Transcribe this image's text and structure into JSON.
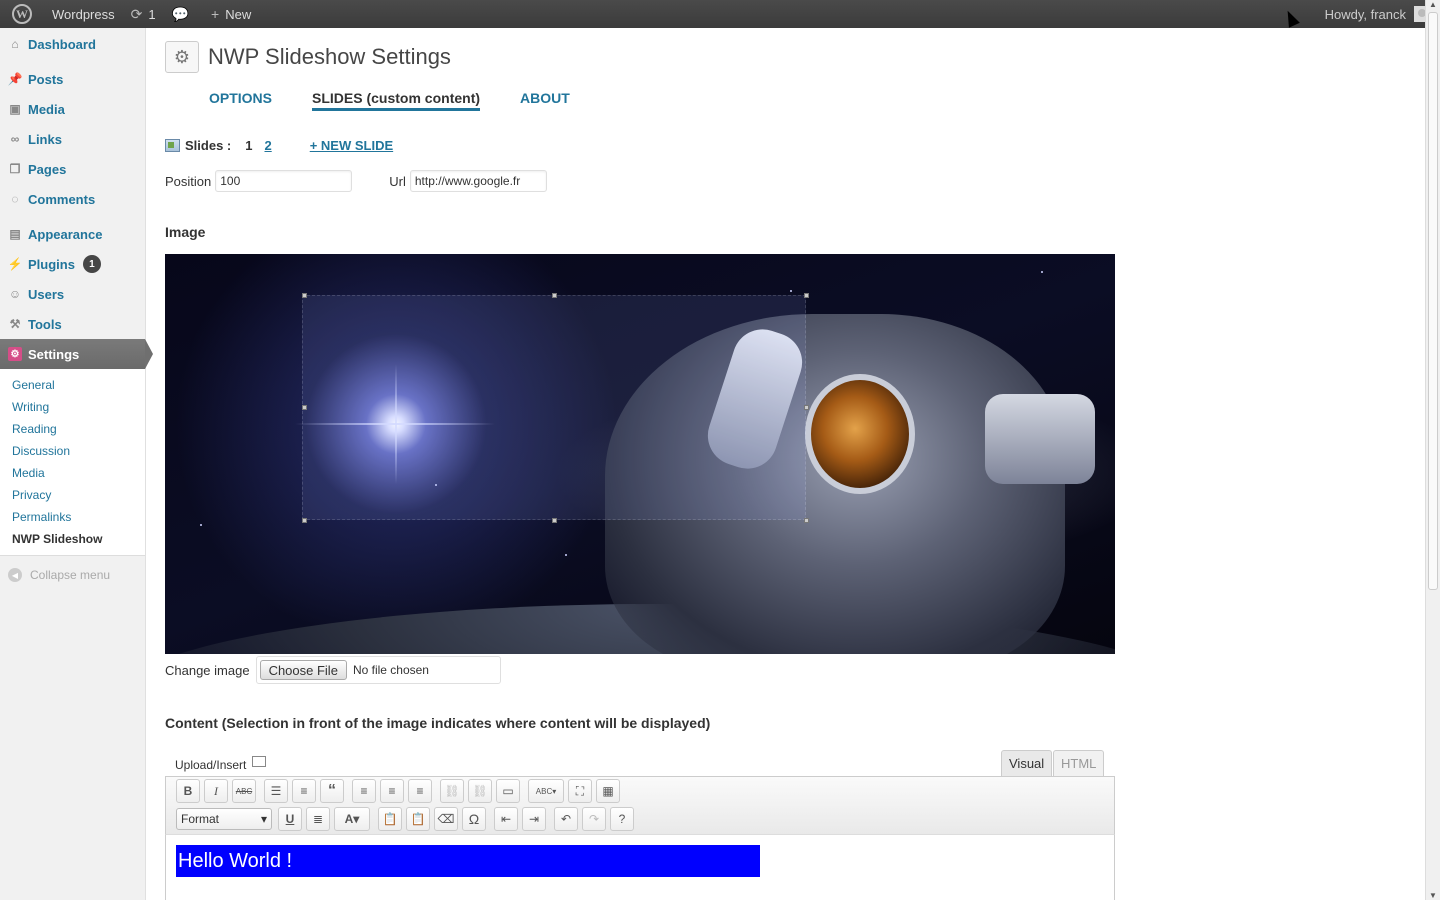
{
  "adminbar": {
    "site_name": "Wordpress",
    "updates_count": "1",
    "new_label": "New",
    "howdy": "Howdy, franck"
  },
  "sidebar": {
    "items": [
      {
        "label": "Dashboard",
        "icon": "dashboard-icon"
      },
      {
        "label": "Posts",
        "icon": "posts-icon"
      },
      {
        "label": "Media",
        "icon": "media-icon"
      },
      {
        "label": "Links",
        "icon": "links-icon"
      },
      {
        "label": "Pages",
        "icon": "pages-icon"
      },
      {
        "label": "Comments",
        "icon": "comments-icon"
      },
      {
        "label": "Appearance",
        "icon": "appearance-icon"
      },
      {
        "label": "Plugins",
        "icon": "plugins-icon",
        "badge": "1"
      },
      {
        "label": "Users",
        "icon": "users-icon"
      },
      {
        "label": "Tools",
        "icon": "tools-icon"
      },
      {
        "label": "Settings",
        "icon": "settings-icon"
      }
    ],
    "settings_submenu": [
      "General",
      "Writing",
      "Reading",
      "Discussion",
      "Media",
      "Privacy",
      "Permalinks",
      "NWP Slideshow"
    ],
    "collapse_label": "Collapse menu"
  },
  "page": {
    "title": "NWP Slideshow Settings",
    "tabs": [
      "OPTIONS",
      "SLIDES (custom content)",
      "ABOUT"
    ],
    "active_tab": "SLIDES (custom content)"
  },
  "slides": {
    "label": "Slides :",
    "current": "1",
    "other": "2",
    "new_slide": "+ NEW SLIDE"
  },
  "fields": {
    "position_label": "Position",
    "position_value": "100",
    "url_label": "Url",
    "url_value": "http://www.google.fr"
  },
  "image_section": {
    "heading": "Image",
    "change_label": "Change image",
    "choose_button": "Choose File",
    "file_status": "No file chosen"
  },
  "content_section": {
    "heading": "Content (Selection in front of the image indicates where content will be displayed)",
    "upload_insert": "Upload/Insert",
    "tab_visual": "Visual",
    "tab_html": "HTML",
    "format_label": "Format",
    "editor_text": "Hello World !"
  },
  "colors": {
    "link": "#21759b",
    "selection": "#0000ff",
    "admin_bar": "#464646"
  }
}
